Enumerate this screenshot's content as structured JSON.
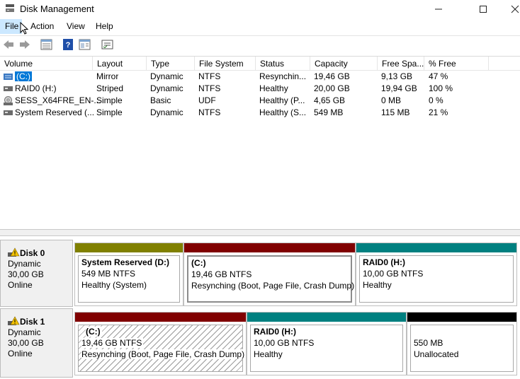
{
  "window": {
    "title": "Disk Management",
    "minimize": "—",
    "maximize": "☐",
    "close": "✕"
  },
  "menu": {
    "file": "File",
    "action": "Action",
    "view": "View",
    "help": "Help"
  },
  "toolbar": {
    "icons": [
      "back-arrow-icon",
      "forward-arrow-icon",
      "disk-list-icon",
      "help-icon",
      "console-properties-icon",
      "properties-icon"
    ]
  },
  "volume_list": {
    "columns": [
      "Volume",
      "Layout",
      "Type",
      "File System",
      "Status",
      "Capacity",
      "Free Spa...",
      "% Free"
    ],
    "rows": [
      {
        "volume": "(C:)",
        "layout": "Mirror",
        "type": "Dynamic",
        "fs": "NTFS",
        "status": "Resynchin...",
        "capacity": "19,46 GB",
        "free": "9,13 GB",
        "pct": "47 %",
        "icon": "mirror-volume-icon",
        "selected": true
      },
      {
        "volume": "RAID0 (H:)",
        "layout": "Striped",
        "type": "Dynamic",
        "fs": "NTFS",
        "status": "Healthy",
        "capacity": "20,00 GB",
        "free": "19,94 GB",
        "pct": "100 %",
        "icon": "volume-icon"
      },
      {
        "volume": "SESS_X64FRE_EN-...",
        "layout": "Simple",
        "type": "Basic",
        "fs": "UDF",
        "status": "Healthy (P...",
        "capacity": "4,65 GB",
        "free": "0 MB",
        "pct": "0 %",
        "icon": "cd-drive-icon"
      },
      {
        "volume": "System Reserved (...",
        "layout": "Simple",
        "type": "Dynamic",
        "fs": "NTFS",
        "status": "Healthy (S...",
        "capacity": "549 MB",
        "free": "115 MB",
        "pct": "21 %",
        "icon": "volume-icon"
      }
    ]
  },
  "disks": [
    {
      "name": "Disk 0",
      "type": "Dynamic",
      "size": "30,00 GB",
      "state": "Online",
      "partitions": [
        {
          "title": "System Reserved  (D:)",
          "line2": "549 MB NTFS",
          "line3": "Healthy (System)",
          "color": "#808000"
        },
        {
          "title": "(C:)",
          "line2": "19,46 GB NTFS",
          "line3": "Resynching (Boot, Page File, Crash Dump)",
          "color": "#800000"
        },
        {
          "title": "RAID0  (H:)",
          "line2": "10,00 GB NTFS",
          "line3": "Healthy",
          "color": "#008080"
        }
      ]
    },
    {
      "name": "Disk 1",
      "type": "Dynamic",
      "size": "30,00 GB",
      "state": "Online",
      "partitions": [
        {
          "title": "(C:)",
          "line2": "19,46 GB NTFS",
          "line3": "Resynching (Boot, Page File, Crash Dump)",
          "color": "#800000"
        },
        {
          "title": "RAID0  (H:)",
          "line2": "10,00 GB NTFS",
          "line3": "Healthy",
          "color": "#008080"
        },
        {
          "title": "",
          "line2": "550 MB",
          "line3": "Unallocated",
          "color": "#000000"
        }
      ]
    }
  ]
}
